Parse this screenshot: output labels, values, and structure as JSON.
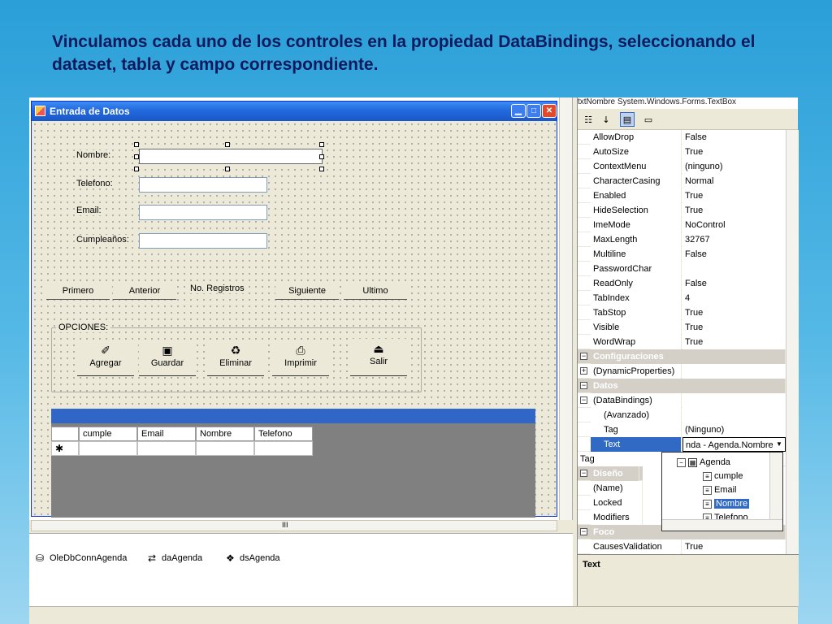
{
  "slide": {
    "title": "Vinculamos cada uno de los controles en la propiedad DataBindings, seleccionando el dataset, tabla y campo correspondiente."
  },
  "form": {
    "title": "Entrada de Datos",
    "labels": {
      "nombre": "Nombre:",
      "telefono": "Telefono:",
      "email": "Email:",
      "cumple": "Cumpleaños:"
    },
    "nav": {
      "primero": "Primero",
      "anterior": "Anterior",
      "registros": "No. Registros",
      "siguiente": "Siguiente",
      "ultimo": "Ultimo"
    },
    "group_label": "OPCIONES:",
    "options": {
      "agregar": "Agregar",
      "guardar": "Guardar",
      "eliminar": "Eliminar",
      "imprimir": "Imprimir",
      "salir": "Salir"
    },
    "grid": {
      "columns": [
        "cumple",
        "Email",
        "Nombre",
        "Telefono"
      ],
      "new_row_marker": "✱"
    }
  },
  "tray": [
    {
      "label": "OleDbConnAgenda",
      "icon": "connection-icon"
    },
    {
      "label": "daAgenda",
      "icon": "dataadapter-icon"
    },
    {
      "label": "dsAgenda",
      "icon": "dataset-icon"
    }
  ],
  "hscroll_marker": "III",
  "properties": {
    "header": "txtNombre  System.Windows.Forms.TextBox",
    "rows": [
      {
        "name": "AllowDrop",
        "value": "False"
      },
      {
        "name": "AutoSize",
        "value": "True"
      },
      {
        "name": "ContextMenu",
        "value": "(ninguno)"
      },
      {
        "name": "CharacterCasing",
        "value": "Normal"
      },
      {
        "name": "Enabled",
        "value": "True"
      },
      {
        "name": "HideSelection",
        "value": "True"
      },
      {
        "name": "ImeMode",
        "value": "NoControl"
      },
      {
        "name": "MaxLength",
        "value": "32767"
      },
      {
        "name": "Multiline",
        "value": "False"
      },
      {
        "name": "PasswordChar",
        "value": ""
      },
      {
        "name": "ReadOnly",
        "value": "False"
      },
      {
        "name": "TabIndex",
        "value": "4"
      },
      {
        "name": "TabStop",
        "value": "True"
      },
      {
        "name": "Visible",
        "value": "True"
      },
      {
        "name": "WordWrap",
        "value": "True"
      }
    ],
    "cat_config": "Configuraciones",
    "dyn_props": "(DynamicProperties)",
    "cat_datos": "Datos",
    "databindings": "(DataBindings)",
    "avanzado": "(Avanzado)",
    "tag_name": "Tag",
    "tag_value": "(Ninguno)",
    "text_name": "Text",
    "text_value": "nda - Agenda.Nombre",
    "tag2_name": "Tag",
    "cat_diseno": "Diseño",
    "name_prop": "(Name)",
    "locked": "Locked",
    "modifiers": "Modifiers",
    "cat_foco": "Foco",
    "causes": "CausesValidation",
    "causes_value": "True",
    "description": "Text"
  },
  "dropdown": {
    "table": "Agenda",
    "fields": [
      "cumple",
      "Email",
      "Nombre",
      "Telefono"
    ],
    "selected": "Nombre"
  }
}
